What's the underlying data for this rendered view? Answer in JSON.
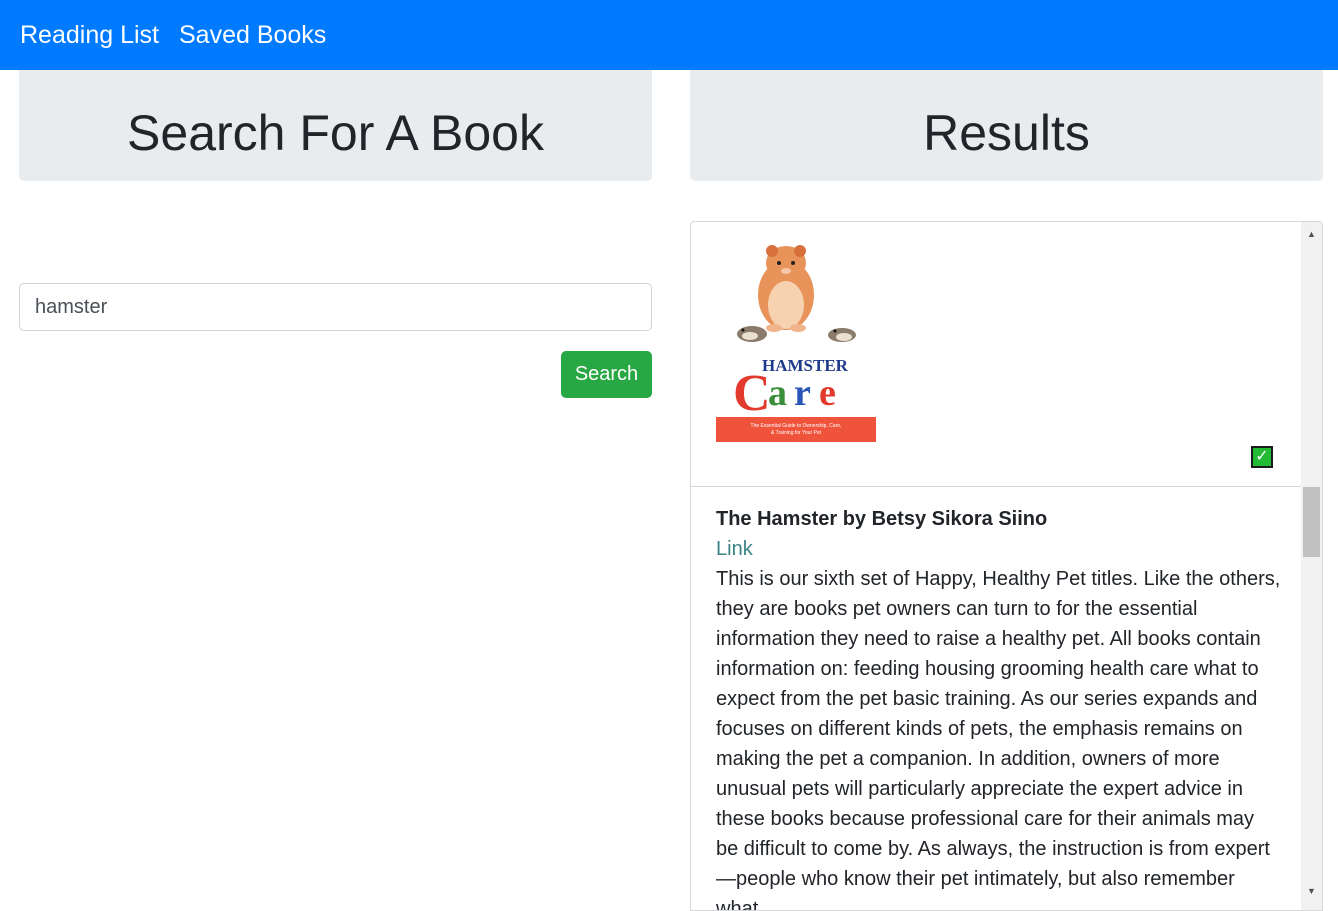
{
  "navbar": {
    "brand": "Reading List",
    "links": [
      "Saved Books"
    ],
    "color": "#007bff"
  },
  "search_section": {
    "heading": "Search For A Book",
    "input_value": "hamster",
    "button_label": "Search",
    "button_color": "#28a745"
  },
  "results_section": {
    "heading": "Results",
    "books": [
      {
        "cover_title_line1": "HAMSTER",
        "cover_title_line2": "Care",
        "cover_subtitle": "The Essential Guide to Ownership, Care, & Training for Your Pet",
        "saved": true,
        "saved_icon": "check-icon",
        "title": "The Hamster by Betsy Sikora Siino",
        "link_label": "Link",
        "description": "This is our sixth set of Happy, Healthy Pet titles. Like the others, they are books pet owners can turn to for the essential information they need to raise a healthy pet. All books contain information on: feeding housing grooming health care what to expect from the pet basic training. As our series expands and focuses on different kinds of pets, the emphasis remains on making the pet a companion. In addition, owners of more unusual pets will particularly appreciate the expert advice in these books because professional care for their animals may be difficult to come by. As always, the instruction is from expert—people who know their pet intimately, but also remember what"
      }
    ]
  },
  "colors": {
    "jumbotron_bg": "#e9ecef",
    "link_color": "#3a8286",
    "saved_badge": "#22bb33"
  }
}
